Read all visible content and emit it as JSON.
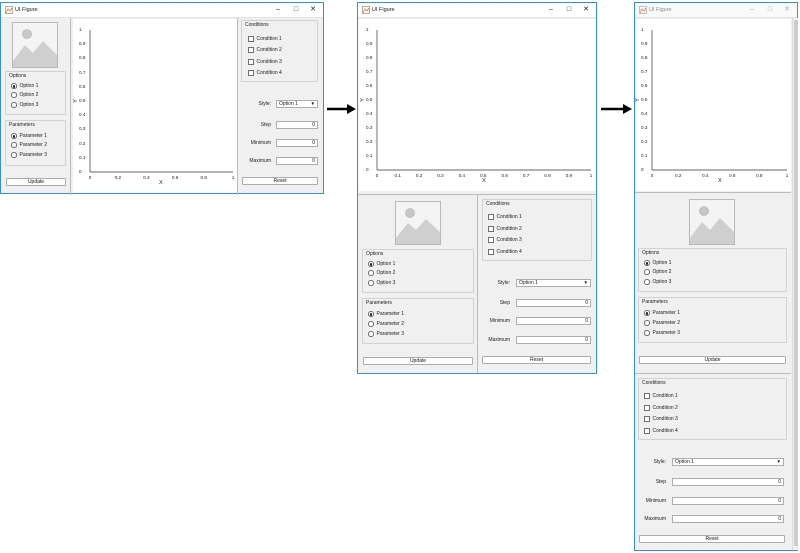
{
  "window": {
    "title": "UI Figure",
    "minimize": "–",
    "maximize": "□",
    "close": "✕"
  },
  "panels": {
    "options": {
      "title": "Options",
      "items": [
        "Option 1",
        "Option 2",
        "Option 3"
      ],
      "selected": 0
    },
    "parameters": {
      "title": "Parameters",
      "items": [
        "Parameter 1",
        "Parameter 2",
        "Parameter 3"
      ],
      "selected": 0
    },
    "conditions": {
      "title": "Conditions",
      "items": [
        "Condition 1",
        "Condition 2",
        "Condition 3",
        "Condition 4"
      ]
    }
  },
  "controls": {
    "style_label": "Style:",
    "style_value": "Option 1",
    "step_label": "Step",
    "step_value": "0",
    "minimum_label": "Minimum",
    "minimum_value": "0",
    "maximum_label": "Maximum",
    "maximum_value": "0",
    "update_label": "Update",
    "reset_label": "Reset"
  },
  "axes": {
    "xlabel": "X",
    "ylabel": "Y",
    "yticks": [
      "0",
      "0.1",
      "0.2",
      "0.3",
      "0.4",
      "0.5",
      "0.6",
      "0.7",
      "0.8",
      "0.9",
      "1"
    ],
    "xticks_coarse": [
      "0",
      "0.2",
      "0.4",
      "0.6",
      "0.8",
      "1"
    ],
    "xticks_fine": [
      "0",
      "0.1",
      "0.2",
      "0.3",
      "0.4",
      "0.5",
      "0.6",
      "0.7",
      "0.8",
      "0.9",
      "1"
    ]
  },
  "icons": {
    "app": "matlab-figure-icon",
    "image": "image-placeholder-icon",
    "arrow": "right-arrow-icon"
  },
  "colors": {
    "window_border": "#3c8ed4",
    "panel_bg": "#f0f0f0",
    "axes_bg": "#ffffff"
  }
}
